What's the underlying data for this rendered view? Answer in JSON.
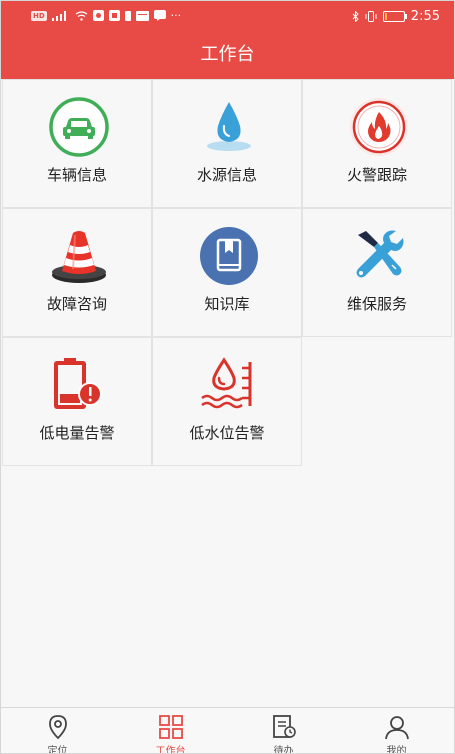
{
  "status_bar": {
    "left_icons": [
      "hd-icon",
      "signal-icon",
      "wifi-icon",
      "app-icon",
      "app-icon",
      "battery-small-icon",
      "message-icon",
      "chat-icon",
      "more-icon"
    ],
    "hd_label": "HD",
    "more": "···",
    "time": "2:55",
    "battery_level": 0.15
  },
  "header": {
    "title": "工作台"
  },
  "grid": {
    "items": [
      {
        "label": "车辆信息",
        "icon": "car-icon"
      },
      {
        "label": "水源信息",
        "icon": "water-drop-icon"
      },
      {
        "label": "火警跟踪",
        "icon": "fire-icon"
      },
      {
        "label": "故障咨询",
        "icon": "traffic-cone-icon"
      },
      {
        "label": "知识库",
        "icon": "book-icon"
      },
      {
        "label": "维保服务",
        "icon": "tools-icon"
      },
      {
        "label": "低电量告警",
        "icon": "low-battery-alert-icon"
      },
      {
        "label": "低水位告警",
        "icon": "low-water-alert-icon"
      }
    ]
  },
  "tabbar": {
    "tabs": [
      {
        "label": "定位",
        "icon": "location-icon",
        "active": false
      },
      {
        "label": "工作台",
        "icon": "grid-icon",
        "active": true
      },
      {
        "label": "待办",
        "icon": "todo-icon",
        "active": false
      },
      {
        "label": "我的",
        "icon": "user-icon",
        "active": false
      }
    ]
  },
  "colors": {
    "primary": "#e84b46",
    "green": "#3fae57",
    "blue": "#3aa0d8",
    "book_blue": "#4a72b0",
    "red_icon": "#d9342b"
  }
}
